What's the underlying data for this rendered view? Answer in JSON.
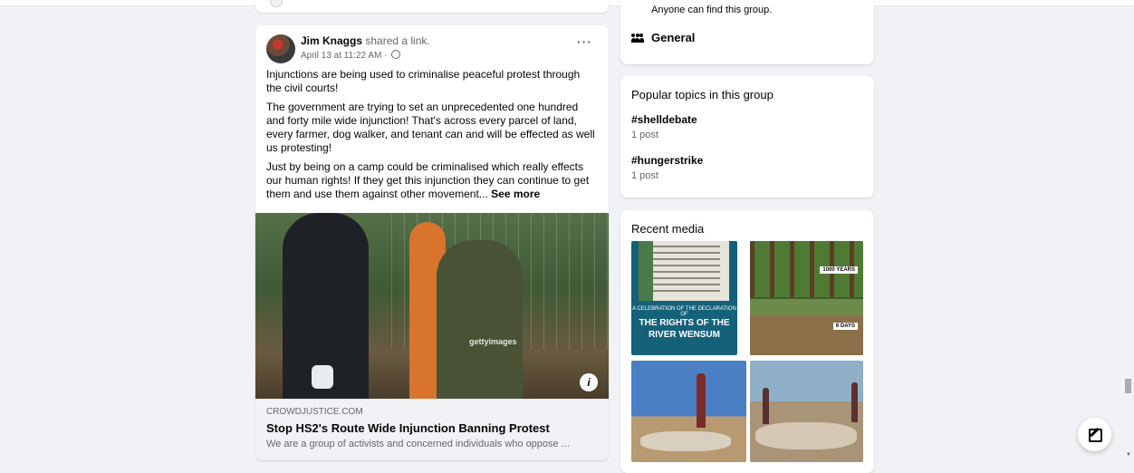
{
  "post": {
    "author": "Jim Knaggs",
    "action": "shared a link.",
    "timestamp": "April 13 at 11:22 AM ·",
    "more_label": "···",
    "paragraphs": [
      "Injunctions are being used to criminalise peaceful protest through the civil courts!",
      "The government are trying to set an unprecedented one hundred and forty mile wide injunction! That's across every parcel of land, every farmer, dog walker, and tenant can and will be effected as well us protesting!",
      "Just by being on a camp could be criminalised which really effects our human rights! If they get this injunction they can continue to get them and use them against other movement... "
    ],
    "see_more": "See more",
    "image_watermark": "gettyimages",
    "info_label": "i",
    "link": {
      "domain": "CROWDJUSTICE.COM",
      "title": "Stop HS2's Route Wide Injunction Banning Protest",
      "description": "We are a group of activists and concerned individuals who oppose ..."
    }
  },
  "about": {
    "visibility_desc": "Anyone can find this group.",
    "general_label": "General"
  },
  "topics": {
    "heading": "Popular topics in this group",
    "items": [
      {
        "tag": "#shelldebate",
        "count": "1 post"
      },
      {
        "tag": "#hungerstrike",
        "count": "1 post"
      }
    ]
  },
  "media": {
    "heading": "Recent media",
    "tile1": {
      "line1": "A CELEBRATION OF THE DECLARATION OF",
      "line2": "THE RIGHTS OF THE RIVER WENSUM"
    },
    "tile2": {
      "label_top": "1000 YEARS",
      "label_bottom": "6 DAYS"
    }
  }
}
